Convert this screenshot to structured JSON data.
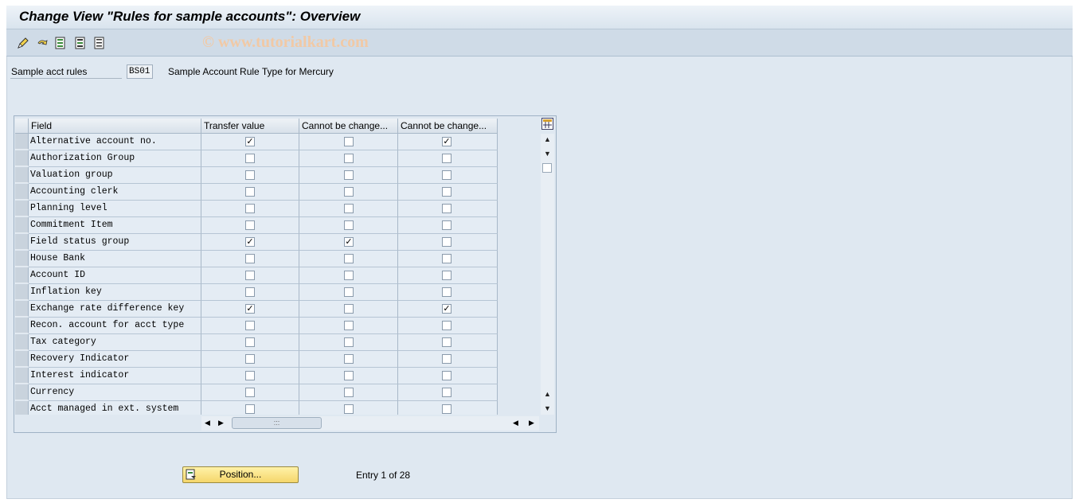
{
  "window": {
    "title": "Change View \"Rules for sample accounts\": Overview",
    "watermark": "© www.tutorialkart.com"
  },
  "toolbar": {
    "icons": [
      "edit-pencil-icon",
      "undo-icon",
      "select-all-icon",
      "select-block-icon",
      "deselect-all-icon"
    ]
  },
  "header": {
    "label": "Sample acct rules",
    "value": "BS01",
    "description": "Sample Account Rule Type for Mercury"
  },
  "table": {
    "columns": [
      "Field",
      "Transfer value",
      "Cannot be change...",
      "Cannot be change..."
    ],
    "rows": [
      {
        "field": "Alternative account no.",
        "transfer": true,
        "nochange1": false,
        "nochange2": true
      },
      {
        "field": "Authorization Group",
        "transfer": false,
        "nochange1": false,
        "nochange2": false
      },
      {
        "field": "Valuation group",
        "transfer": false,
        "nochange1": false,
        "nochange2": false
      },
      {
        "field": "Accounting clerk",
        "transfer": false,
        "nochange1": false,
        "nochange2": false
      },
      {
        "field": "Planning level",
        "transfer": false,
        "nochange1": false,
        "nochange2": false
      },
      {
        "field": "Commitment Item",
        "transfer": false,
        "nochange1": false,
        "nochange2": false
      },
      {
        "field": "Field status group",
        "transfer": true,
        "nochange1": true,
        "nochange2": false
      },
      {
        "field": "House Bank",
        "transfer": false,
        "nochange1": false,
        "nochange2": false
      },
      {
        "field": "Account ID",
        "transfer": false,
        "nochange1": false,
        "nochange2": false
      },
      {
        "field": "Inflation key",
        "transfer": false,
        "nochange1": false,
        "nochange2": false
      },
      {
        "field": "Exchange rate difference key",
        "transfer": true,
        "nochange1": false,
        "nochange2": true
      },
      {
        "field": "Recon. account for acct type",
        "transfer": false,
        "nochange1": false,
        "nochange2": false
      },
      {
        "field": "Tax category",
        "transfer": false,
        "nochange1": false,
        "nochange2": false
      },
      {
        "field": "Recovery Indicator",
        "transfer": false,
        "nochange1": false,
        "nochange2": false
      },
      {
        "field": "Interest indicator",
        "transfer": false,
        "nochange1": false,
        "nochange2": false
      },
      {
        "field": "Currency",
        "transfer": false,
        "nochange1": false,
        "nochange2": false
      },
      {
        "field": "Acct managed in ext. system",
        "transfer": false,
        "nochange1": false,
        "nochange2": false
      }
    ]
  },
  "footer": {
    "position_button": "Position...",
    "entry_text": "Entry 1 of 28"
  }
}
